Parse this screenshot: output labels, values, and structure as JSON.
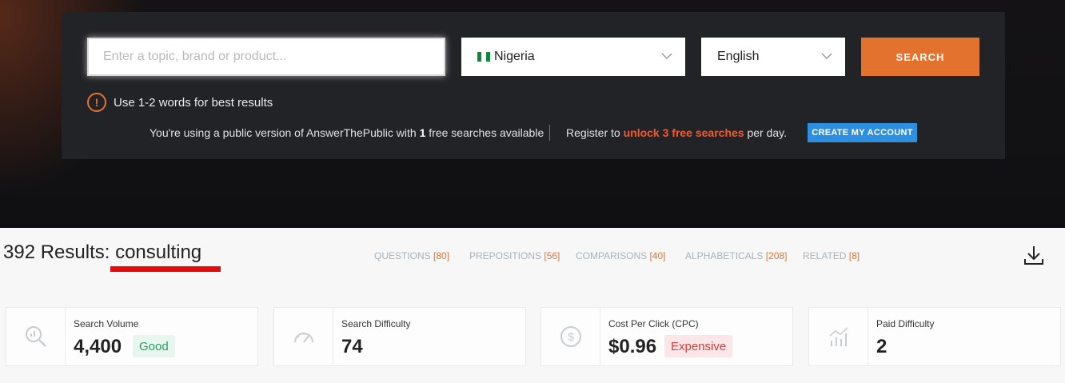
{
  "search": {
    "placeholder": "Enter a topic, brand or product...",
    "country": "Nigeria",
    "language": "English",
    "button_label": "SEARCH",
    "hint": "Use 1-2 words for best results",
    "hint_icon": "!"
  },
  "notice": {
    "prefix": "You're using a public version of AnswerThePublic with ",
    "count": "1",
    "suffix": " free searches available",
    "register_prefix": "Register to ",
    "register_highlight": "unlock 3 free searches",
    "register_suffix": " per day.",
    "create_account_label": "CREATE MY ACCOUNT"
  },
  "results": {
    "count_label": "392 Results: ",
    "keyword": "consulting",
    "tabs": [
      {
        "label": "QUESTIONS ",
        "count": "[80]"
      },
      {
        "label": "PREPOSITIONS ",
        "count": "[56]"
      },
      {
        "label": "COMPARISONS ",
        "count": "[40]"
      },
      {
        "label": "ALPHABETICALS ",
        "count": "[208]"
      },
      {
        "label": "RELATED ",
        "count": "[8]"
      }
    ]
  },
  "metrics": [
    {
      "label": "Search Volume",
      "value": "4,400",
      "badge": "Good",
      "icon": "search-chart-icon"
    },
    {
      "label": "Search Difficulty",
      "value": "74",
      "icon": "gauge-icon"
    },
    {
      "label": "Cost Per Click (CPC)",
      "value": "$0.96",
      "badge": "Expensive",
      "icon": "dollar-icon"
    },
    {
      "label": "Paid Difficulty",
      "value": "2",
      "icon": "bar-trend-icon"
    }
  ],
  "colors": {
    "accent_orange": "#e4722f",
    "blue_button": "#2c8fe0",
    "highlight_red": "#ef5b32",
    "underline_red": "#e60b0b"
  }
}
